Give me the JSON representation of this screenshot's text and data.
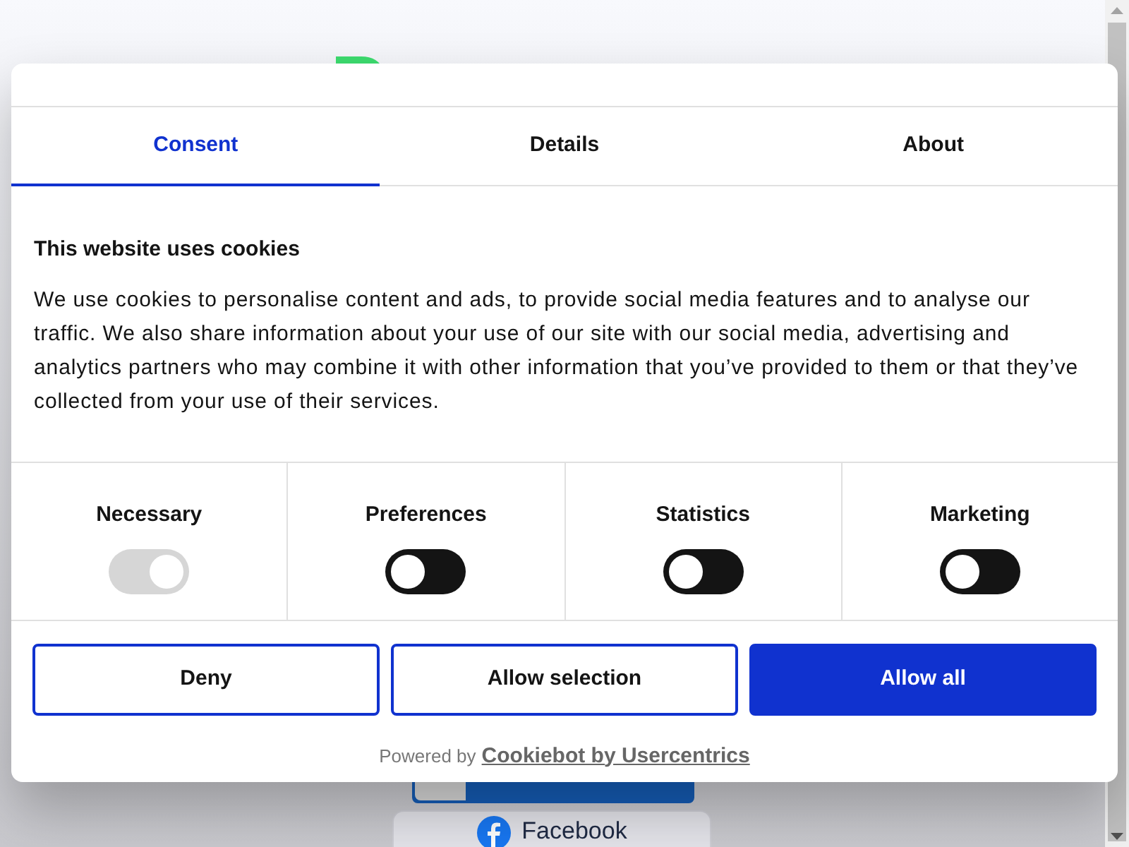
{
  "background": {
    "social_button": {
      "label": "Facebook"
    }
  },
  "tabs": [
    {
      "label": "Consent",
      "selected": true
    },
    {
      "label": "Details",
      "selected": false
    },
    {
      "label": "About",
      "selected": false
    }
  ],
  "heading": "This website uses cookies",
  "body": "We use cookies to personalise content and ads, to provide social media features and to analyse our traffic. We also share information about your use of our site with our social media, advertising and analytics partners who may combine it with other information that you’ve provided to them or that they’ve collected from your use of their services.",
  "categories": [
    {
      "label": "Necessary",
      "checked": true,
      "disabled": true
    },
    {
      "label": "Preferences",
      "checked": false,
      "disabled": false
    },
    {
      "label": "Statistics",
      "checked": false,
      "disabled": false
    },
    {
      "label": "Marketing",
      "checked": false,
      "disabled": false
    }
  ],
  "buttons": [
    {
      "label": "Deny",
      "kind": "outline"
    },
    {
      "label": "Allow selection",
      "kind": "outline"
    },
    {
      "label": "Allow all",
      "kind": "primary"
    }
  ],
  "footer": {
    "prefix": "Powered by",
    "link": "Cookiebot by Usercentrics"
  }
}
